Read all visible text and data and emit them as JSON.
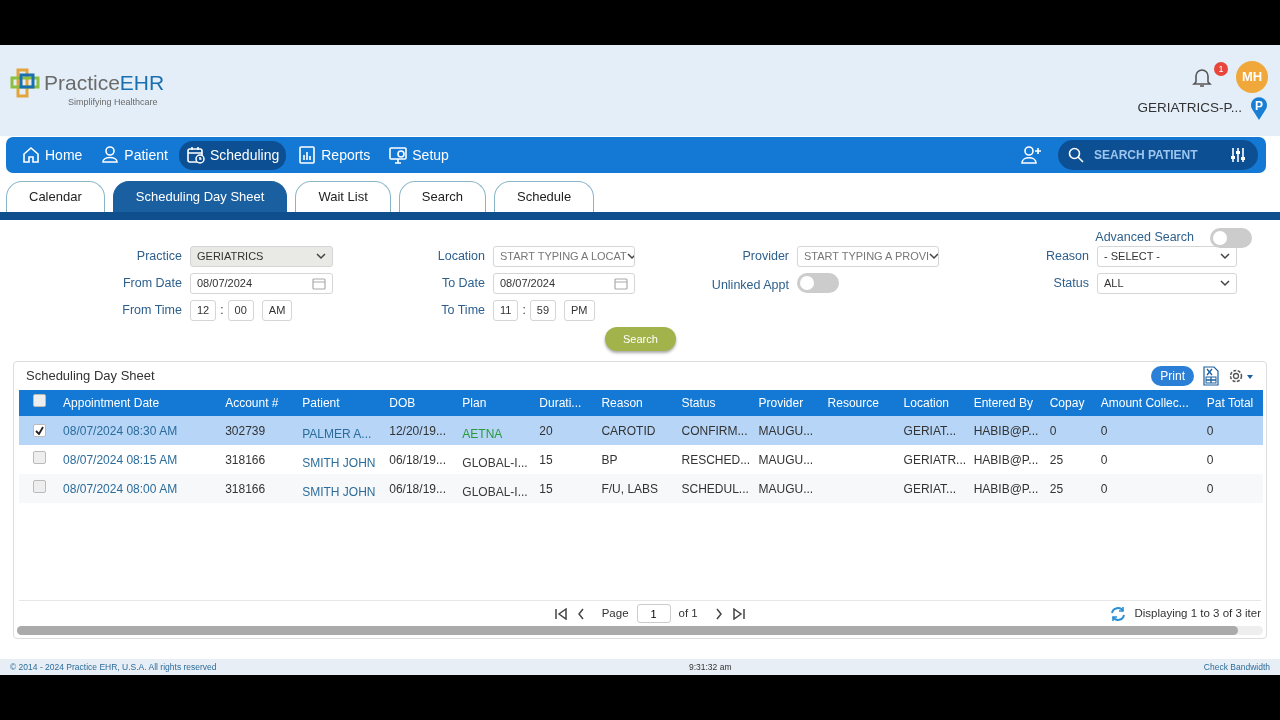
{
  "logo": {
    "word_1": "Practice",
    "word_2": "EHR",
    "tagline": "Simplifying Healthcare"
  },
  "notifications": {
    "count": "1"
  },
  "user": {
    "initials": "MH"
  },
  "practice": {
    "name": "GERIATRICS-P...",
    "pin": "P"
  },
  "nav": [
    {
      "label": "Home",
      "selected": false
    },
    {
      "label": "Patient",
      "selected": false
    },
    {
      "label": "Scheduling",
      "selected": true
    },
    {
      "label": "Reports",
      "selected": false
    },
    {
      "label": "Setup",
      "selected": false
    }
  ],
  "patient_search": {
    "placeholder": "SEARCH PATIENT"
  },
  "tabs": [
    {
      "label": "Calendar",
      "selected": false
    },
    {
      "label": "Scheduling Day Sheet",
      "selected": true
    },
    {
      "label": "Wait List",
      "selected": false
    },
    {
      "label": "Search",
      "selected": false
    },
    {
      "label": "Schedule",
      "selected": false
    }
  ],
  "advanced_search": {
    "label": "Advanced Search",
    "on": false
  },
  "filter_columns": [
    [
      {
        "kind": "select",
        "label": "Practice",
        "value": "GERIATRICS",
        "disabled": true
      },
      {
        "kind": "date",
        "label": "From Date",
        "value": "08/07/2024"
      },
      {
        "kind": "time",
        "label": "From Time",
        "hour": "12",
        "separator": ":",
        "minute": "00",
        "period": "AM"
      }
    ],
    [
      {
        "kind": "select",
        "label": "Location",
        "placeholder": "START TYPING A LOCAT",
        "disabled": false
      },
      {
        "kind": "date",
        "label": "To Date",
        "value": "08/07/2024"
      },
      {
        "kind": "time",
        "label": "To Time",
        "hour": "11",
        "separator": ":",
        "minute": "59",
        "period": "PM"
      }
    ],
    [
      {
        "kind": "select",
        "label": "Provider",
        "placeholder": "START TYPING A PROVI",
        "disabled": false
      },
      {
        "kind": "toggle",
        "label": "Unlinked Appt",
        "on": false
      }
    ],
    [
      {
        "kind": "select",
        "label": "Reason",
        "value": "- SELECT -",
        "disabled": false
      },
      {
        "kind": "select",
        "label": "Status",
        "value": "ALL",
        "disabled": false
      }
    ]
  ],
  "search_button": "Search",
  "grid": {
    "title": "Scheduling Day Sheet",
    "print": "Print",
    "header_checked": false,
    "columns": [
      "Appointment Date",
      "Account #",
      "Patient",
      "DOB",
      "Plan",
      "Durati...",
      "Reason",
      "Status",
      "Provider",
      "Resource",
      "Location",
      "Entered By",
      "Copay",
      "Amount Collec...",
      "Pat Total"
    ],
    "rows": [
      {
        "selected": true,
        "color": "#2a9a3c",
        "cells": [
          "08/07/2024 08:30 AM",
          "302739",
          "PALMER A...",
          "12/20/19...",
          "AETNA",
          "20",
          "CAROTID",
          "CONFIRM...",
          "MAUGU...",
          "",
          "GERIAT...",
          "HABIB@P...",
          "0",
          "0",
          "0"
        ]
      },
      {
        "selected": false,
        "color": "#3a3a3a",
        "cells": [
          "08/07/2024 08:15 AM",
          "318166",
          "SMITH JOHN",
          "06/18/19...",
          "GLOBAL-I...",
          "15",
          "BP",
          "RESCHED...",
          "MAUGU...",
          "",
          "GERIATR...",
          "HABIB@P...",
          "25",
          "0",
          "0"
        ]
      },
      {
        "selected": false,
        "color": "#3a3a3a",
        "cells": [
          "08/07/2024 08:00 AM",
          "318166",
          "SMITH JOHN",
          "06/18/19...",
          "GLOBAL-I...",
          "15",
          "F/U, LABS",
          "SCHEDUL...",
          "MAUGU...",
          "",
          "GERIAT...",
          "HABIB@P...",
          "25",
          "0",
          "0"
        ]
      }
    ],
    "pager": {
      "page_label": "Page",
      "page": "1",
      "of": "of 1",
      "summary": "Displaying 1 to 3 of 3 iter"
    }
  },
  "footer": {
    "copyright": "© 2014 - 2024 Practice EHR, U.S.A. All rights reserved",
    "clock": "9:31:32 am",
    "link": "Check Bandwidth"
  }
}
